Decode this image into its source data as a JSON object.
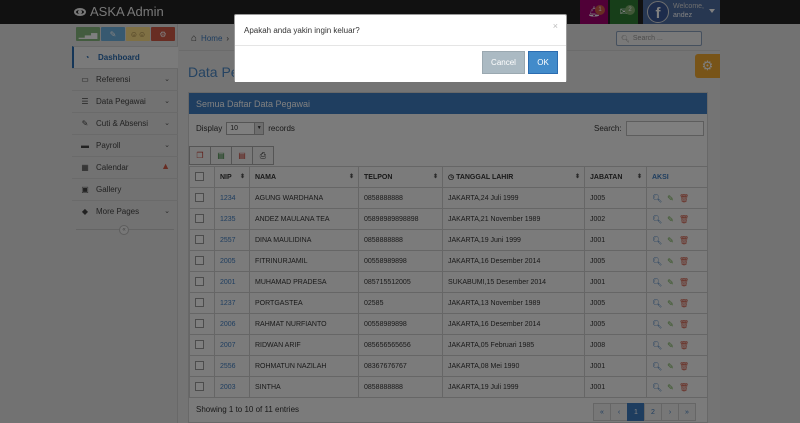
{
  "app": {
    "title": "ASKA Admin"
  },
  "topbar": {
    "notifications": {
      "count": "1",
      "color": "#d15b47"
    },
    "messages": {
      "count": "2",
      "color": "#82af6f"
    },
    "user": {
      "welcome": "Welcome,",
      "name": "andez",
      "avatar_letter": "f"
    }
  },
  "sidebar": {
    "shortcuts": [
      {
        "icon": "signal-icon",
        "color": "#87b87f"
      },
      {
        "icon": "pencil-icon",
        "color": "#6fb3e0"
      },
      {
        "icon": "users-icon",
        "color": "#fee188"
      },
      {
        "icon": "cogs-icon",
        "color": "#d15b47"
      }
    ],
    "items": [
      {
        "label": "Dashboard",
        "icon": "dashboard-icon"
      },
      {
        "label": "Referensi",
        "icon": "desktop-icon"
      },
      {
        "label": "Data Pegawai",
        "icon": "list-icon"
      },
      {
        "label": "Cuti & Absensi",
        "icon": "edit-icon"
      },
      {
        "label": "Payroll",
        "icon": "credit-card-icon"
      },
      {
        "label": "Calendar",
        "icon": "calendar-icon"
      },
      {
        "label": "Gallery",
        "icon": "picture-icon"
      },
      {
        "label": "More Pages",
        "icon": "tag-icon"
      }
    ]
  },
  "breadcrumb": {
    "home": "Home",
    "sep": "›"
  },
  "search_top": {
    "placeholder": "Search ..."
  },
  "page": {
    "title": "Data Pegawai"
  },
  "panel": {
    "heading": "Semua Daftar Data Pegawai",
    "display_label": "Display",
    "display_value": "10",
    "records_label": "records",
    "search_label": "Search:"
  },
  "table": {
    "headers": [
      "NIP",
      "NAMA",
      "TELPON",
      "TANGGAL LAHIR",
      "JABATAN",
      "AKSI"
    ],
    "rows": [
      [
        "1234",
        "AGUNG WARDHANA",
        "0858888888",
        "JAKARTA,24 Juli 1999",
        "J005"
      ],
      [
        "1235",
        "ANDEZ MAULANA TEA",
        "05898989898898",
        "JAKARTA,21 November 1989",
        "J002"
      ],
      [
        "2557",
        "DINA MAULIDINA",
        "0858888888",
        "JAKARTA,19 Juni 1999",
        "J001"
      ],
      [
        "2005",
        "FITRINURJAMIL",
        "00558989898",
        "JAKARTA,16 Desember 2014",
        "J005"
      ],
      [
        "2001",
        "MUHAMAD PRADESA",
        "085715512005",
        "SUKABUMI,15 Desember 2014",
        "J001"
      ],
      [
        "1237",
        "PORTGASTEA",
        "02585",
        "JAKARTA,13 November 1989",
        "J005"
      ],
      [
        "2006",
        "RAHMAT NURFIANTO",
        "00558989898",
        "JAKARTA,16 Desember 2014",
        "J005"
      ],
      [
        "2007",
        "RIDWAN ARIF",
        "085656565656",
        "JAKARTA,05 Februari 1985",
        "J008"
      ],
      [
        "2556",
        "ROHMATUN NAZILAH",
        "08367676767",
        "JAKARTA,08 Mei 1990",
        "J001"
      ],
      [
        "2003",
        "SINTHA",
        "0858888888",
        "JAKARTA,19 Juli 1999",
        "J001"
      ]
    ]
  },
  "footer": {
    "showing": "Showing 1 to 10 of 11 entries",
    "pages": [
      "«",
      "‹",
      "1",
      "2",
      "›",
      "»"
    ]
  },
  "modal": {
    "message": "Apakah anda yakin ingin keluar?",
    "close": "×",
    "cancel_label": "Cancel",
    "ok_label": "OK"
  },
  "colors": {
    "accent": "#428bca",
    "panel_header": "#3f7cc0",
    "gear": "#f0a830"
  }
}
